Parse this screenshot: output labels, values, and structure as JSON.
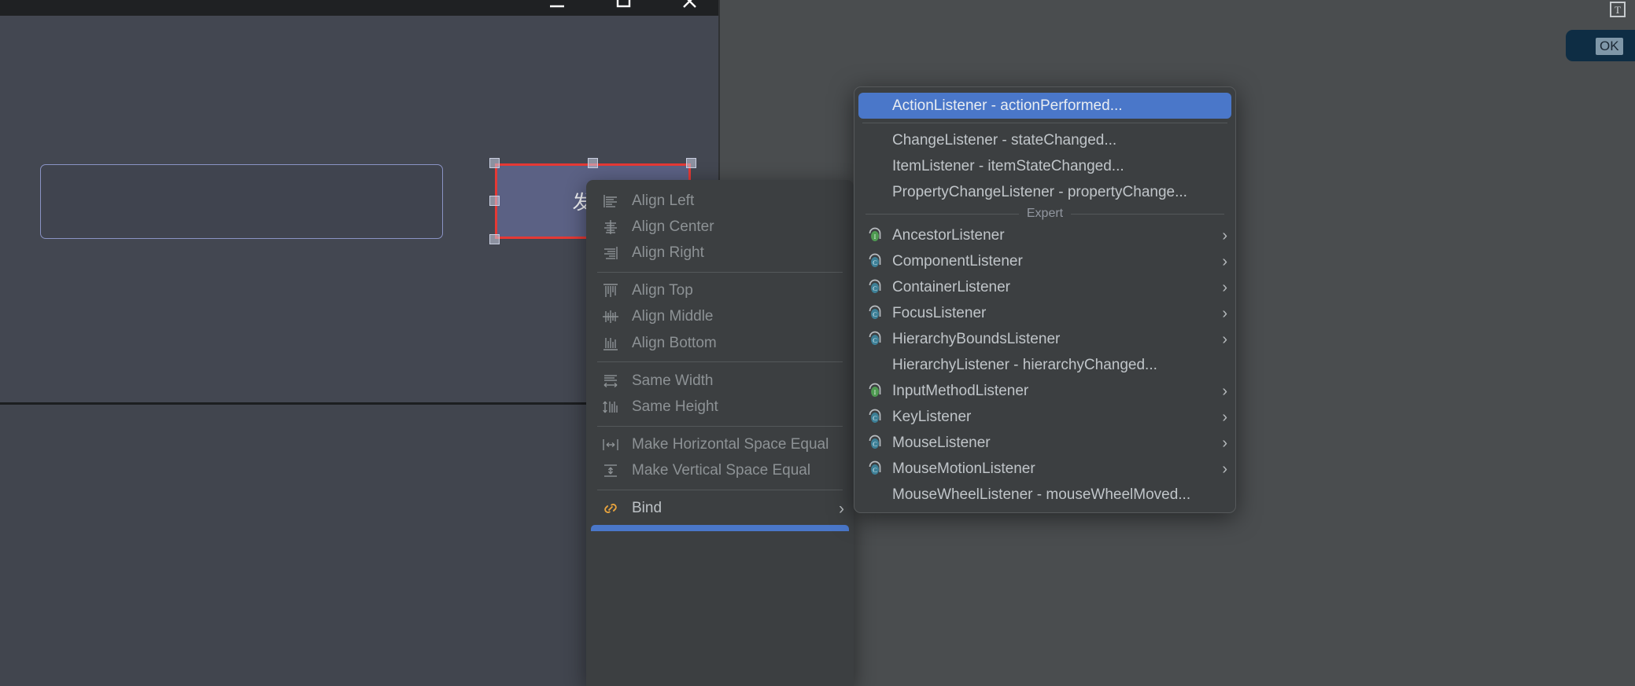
{
  "window": {
    "controls": [
      {
        "name": "minimize",
        "glyph": "minimize-icon"
      },
      {
        "name": "maximize",
        "glyph": "maximize-icon"
      },
      {
        "name": "close",
        "glyph": "close-icon"
      }
    ]
  },
  "form": {
    "text_field_value": "",
    "button_label": "发送"
  },
  "right_panel": {
    "text_tool_label": "T",
    "ok_button_label": "OK"
  },
  "context_menu": {
    "items": [
      {
        "label": "Align Left",
        "icon": "align-left-icon",
        "enabled": false,
        "submenu": false
      },
      {
        "label": "Align Center",
        "icon": "align-center-icon",
        "enabled": false,
        "submenu": false
      },
      {
        "label": "Align Right",
        "icon": "align-right-icon",
        "enabled": false,
        "submenu": false
      },
      {
        "separator": true
      },
      {
        "label": "Align Top",
        "icon": "align-top-icon",
        "enabled": false,
        "submenu": false
      },
      {
        "label": "Align Middle",
        "icon": "align-middle-icon",
        "enabled": false,
        "submenu": false
      },
      {
        "label": "Align Bottom",
        "icon": "align-bottom-icon",
        "enabled": false,
        "submenu": false
      },
      {
        "separator": true
      },
      {
        "label": "Same Width",
        "icon": "same-width-icon",
        "enabled": false,
        "submenu": false
      },
      {
        "label": "Same Height",
        "icon": "same-height-icon",
        "enabled": false,
        "submenu": false
      },
      {
        "separator": true
      },
      {
        "label": "Make Horizontal Space Equal",
        "icon": "horizontal-space-icon",
        "enabled": false,
        "submenu": false
      },
      {
        "label": "Make Vertical Space Equal",
        "icon": "vertical-space-icon",
        "enabled": false,
        "submenu": false
      },
      {
        "separator": true
      },
      {
        "label": "Bind",
        "icon": "link-icon",
        "enabled": true,
        "submenu": true,
        "arrow": "›"
      }
    ]
  },
  "listener_menu": {
    "group_label": "Expert",
    "items": [
      {
        "label": "ActionListener - actionPerformed...",
        "icon": null,
        "selected": true,
        "submenu": false
      },
      {
        "separator": true
      },
      {
        "label": "ChangeListener - stateChanged...",
        "icon": null,
        "selected": false,
        "submenu": false
      },
      {
        "label": "ItemListener - itemStateChanged...",
        "icon": null,
        "selected": false,
        "submenu": false
      },
      {
        "label": "PropertyChangeListener - propertyChange...",
        "icon": null,
        "selected": false,
        "submenu": false
      },
      {
        "group": "Expert"
      },
      {
        "label": "AncestorListener",
        "icon": "interface-green-icon",
        "selected": false,
        "submenu": true,
        "arrow": "›"
      },
      {
        "label": "ComponentListener",
        "icon": "class-blue-icon",
        "selected": false,
        "submenu": true,
        "arrow": "›"
      },
      {
        "label": "ContainerListener",
        "icon": "class-blue-icon",
        "selected": false,
        "submenu": true,
        "arrow": "›"
      },
      {
        "label": "FocusListener",
        "icon": "class-blue-icon",
        "selected": false,
        "submenu": true,
        "arrow": "›"
      },
      {
        "label": "HierarchyBoundsListener",
        "icon": "class-blue-icon",
        "selected": false,
        "submenu": true,
        "arrow": "›"
      },
      {
        "label": "HierarchyListener - hierarchyChanged...",
        "icon": null,
        "selected": false,
        "submenu": false
      },
      {
        "label": "InputMethodListener",
        "icon": "interface-green-icon",
        "selected": false,
        "submenu": true,
        "arrow": "›"
      },
      {
        "label": "KeyListener",
        "icon": "class-blue-icon",
        "selected": false,
        "submenu": true,
        "arrow": "›"
      },
      {
        "label": "MouseListener",
        "icon": "class-blue-icon",
        "selected": false,
        "submenu": true,
        "arrow": "›"
      },
      {
        "label": "MouseMotionListener",
        "icon": "class-blue-icon",
        "selected": false,
        "submenu": true,
        "arrow": "›"
      },
      {
        "label": "MouseWheelListener - mouseWheelMoved...",
        "icon": null,
        "selected": false,
        "submenu": false
      }
    ]
  },
  "colors": {
    "accent_selection": "#4a77c9",
    "selection_red": "#e53935",
    "menu_bg": "#3c3f41",
    "form_bg": "#434751",
    "link_orange": "#e8a33d",
    "ok_dialog_bg": "#0e2d44"
  }
}
